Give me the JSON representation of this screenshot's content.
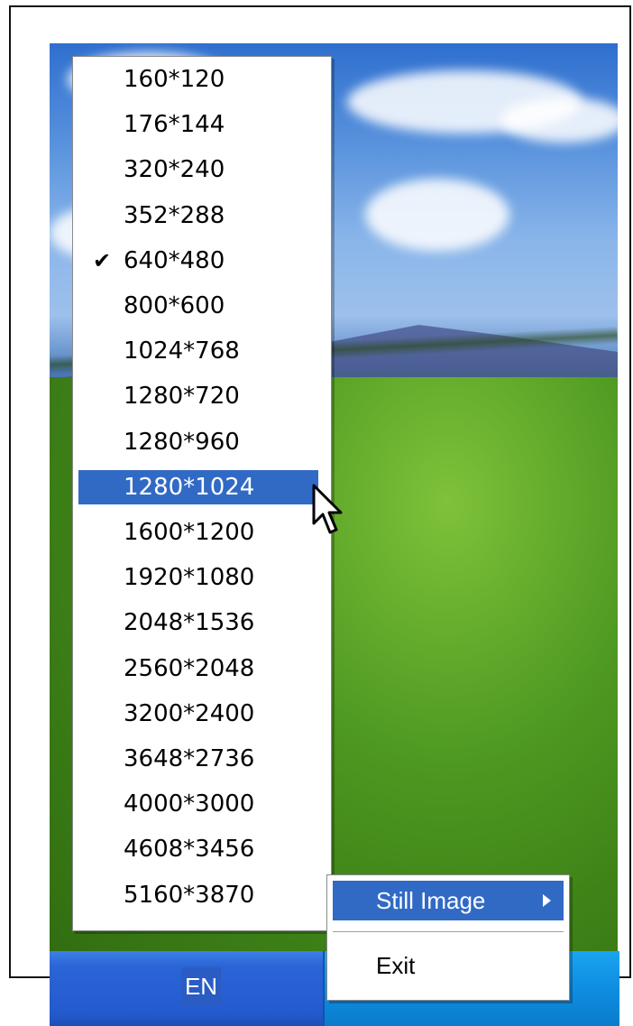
{
  "resolution_menu": {
    "items": [
      {
        "label": "160*120",
        "checked": false,
        "highlighted": false
      },
      {
        "label": "176*144",
        "checked": false,
        "highlighted": false
      },
      {
        "label": "320*240",
        "checked": false,
        "highlighted": false
      },
      {
        "label": "352*288",
        "checked": false,
        "highlighted": false
      },
      {
        "label": "640*480",
        "checked": true,
        "highlighted": false
      },
      {
        "label": "800*600",
        "checked": false,
        "highlighted": false
      },
      {
        "label": "1024*768",
        "checked": false,
        "highlighted": false
      },
      {
        "label": "1280*720",
        "checked": false,
        "highlighted": false
      },
      {
        "label": "1280*960",
        "checked": false,
        "highlighted": false
      },
      {
        "label": "1280*1024",
        "checked": false,
        "highlighted": true
      },
      {
        "label": "1600*1200",
        "checked": false,
        "highlighted": false
      },
      {
        "label": "1920*1080",
        "checked": false,
        "highlighted": false
      },
      {
        "label": "2048*1536",
        "checked": false,
        "highlighted": false
      },
      {
        "label": "2560*2048",
        "checked": false,
        "highlighted": false
      },
      {
        "label": "3200*2400",
        "checked": false,
        "highlighted": false
      },
      {
        "label": "3648*2736",
        "checked": false,
        "highlighted": false
      },
      {
        "label": "4000*3000",
        "checked": false,
        "highlighted": false
      },
      {
        "label": "4608*3456",
        "checked": false,
        "highlighted": false
      },
      {
        "label": "5160*3870",
        "checked": false,
        "highlighted": false
      }
    ]
  },
  "context_menu": {
    "still_image_label": "Still Image",
    "exit_label": "Exit"
  },
  "taskbar": {
    "language": "EN"
  },
  "colors": {
    "highlight": "#316ac5",
    "menu_bg": "#ffffff",
    "taskbar": "#245cd0",
    "tray": "#0f8de0"
  },
  "icons": {
    "check": "check-icon",
    "submenu": "submenu-arrow-icon",
    "cursor": "mouse-cursor-icon"
  }
}
